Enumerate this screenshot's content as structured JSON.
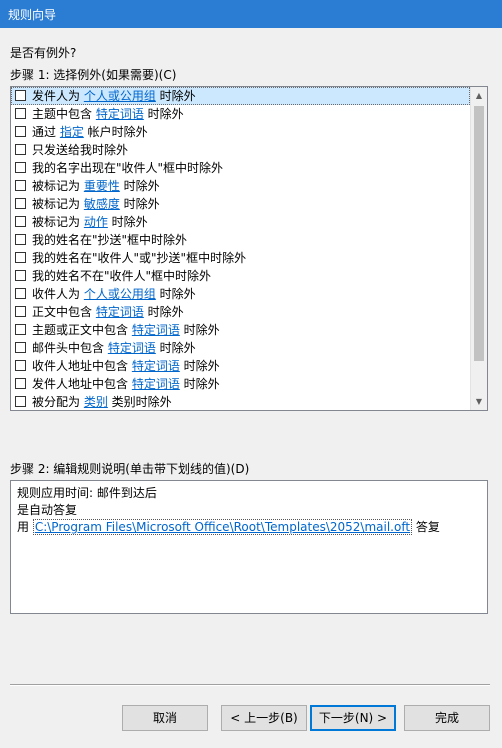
{
  "window": {
    "title": "规则向导"
  },
  "prompt": "是否有例外?",
  "step1": {
    "label": "步骤 1: 选择例外(如果需要)(C)",
    "items": [
      {
        "before": "发件人为 ",
        "link": "个人或公用组",
        "after": " 时除外",
        "selected": true
      },
      {
        "before": "主题中包含 ",
        "link": "特定词语",
        "after": " 时除外"
      },
      {
        "before": "通过 ",
        "link": "指定",
        "after": " 帐户时除外"
      },
      {
        "before": "只发送给我时除外",
        "link": "",
        "after": ""
      },
      {
        "before": "我的名字出现在\"收件人\"框中时除外",
        "link": "",
        "after": ""
      },
      {
        "before": "被标记为 ",
        "link": "重要性",
        "after": " 时除外"
      },
      {
        "before": "被标记为 ",
        "link": "敏感度",
        "after": " 时除外"
      },
      {
        "before": "被标记为 ",
        "link": "动作",
        "after": " 时除外"
      },
      {
        "before": "我的姓名在\"抄送\"框中时除外",
        "link": "",
        "after": ""
      },
      {
        "before": "我的姓名在\"收件人\"或\"抄送\"框中时除外",
        "link": "",
        "after": ""
      },
      {
        "before": "我的姓名不在\"收件人\"框中时除外",
        "link": "",
        "after": ""
      },
      {
        "before": "收件人为 ",
        "link": "个人或公用组",
        "after": " 时除外"
      },
      {
        "before": "正文中包含 ",
        "link": "特定词语",
        "after": " 时除外"
      },
      {
        "before": "主题或正文中包含 ",
        "link": "特定词语",
        "after": " 时除外"
      },
      {
        "before": "邮件头中包含 ",
        "link": "特定词语",
        "after": " 时除外"
      },
      {
        "before": "收件人地址中包含 ",
        "link": "特定词语",
        "after": " 时除外"
      },
      {
        "before": "发件人地址中包含 ",
        "link": "特定词语",
        "after": " 时除外"
      },
      {
        "before": "被分配为 ",
        "link": "类别",
        "after": " 类别时除外"
      }
    ]
  },
  "step2": {
    "label": "步骤 2: 编辑规则说明(单击带下划线的值)(D)",
    "line1": "规则应用时间: 邮件到达后",
    "line2": "是自动答复",
    "line3_prefix": "用 ",
    "template_path": "C:\\Program Files\\Microsoft Office\\Root\\Templates\\2052\\mail.oft",
    "line3_suffix": " 答复"
  },
  "buttons": {
    "cancel": "取消",
    "back": "< 上一步(B)",
    "next": "下一步(N) >",
    "finish": "完成"
  }
}
